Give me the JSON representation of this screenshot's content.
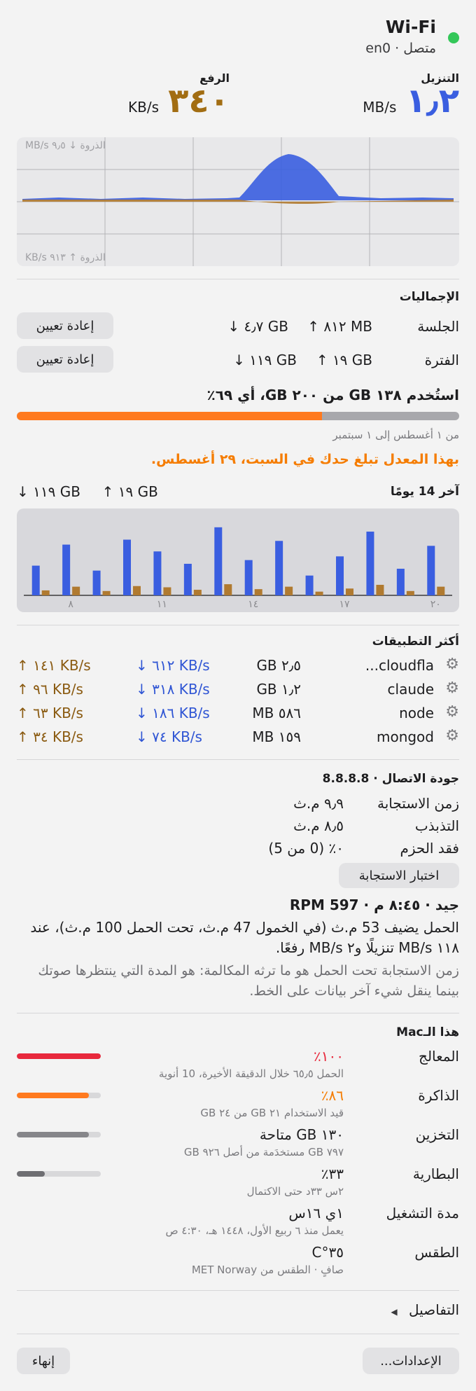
{
  "header": {
    "title": "Wi-Fi",
    "status": "متصل",
    "interface": "en0",
    "status_color": "#34c759",
    "download_label": "التنزيل",
    "download_value": "١٫٢",
    "download_unit": "MB/s",
    "upload_label": "الرفع",
    "upload_value": "٣٤٠",
    "upload_unit": "KB/s"
  },
  "graph": {
    "peak_down": "الذروة ↓ ٩٫٥ MB/s",
    "peak_up": "الذروة ↑ ٩١٣ KB/s",
    "download_color": "#3a5ee0",
    "upload_color": "#b07a30"
  },
  "totals": {
    "title": "الإجماليات",
    "session_label": "الجلسة",
    "session_up": "↑ ٨١٢ MB",
    "session_down": "↓ ٤٫٧ GB",
    "period_label": "الفترة",
    "period_up": "↑ ١٩ GB",
    "period_down": "↓ ١١٩ GB",
    "reset_label": "إعادة تعيين"
  },
  "usage": {
    "text": "استُخدم ١٣٨ GB من ٢٠٠ GB، أي ٦٩٪",
    "percent": 69,
    "bar_color": "#ff7a1f",
    "range": "من ١ أغسطس إلى ١ سبتمبر",
    "warning": "بهذا المعدل تبلغ حدك في السبت، ٢٩ أغسطس.",
    "warning_color": "#f57c00"
  },
  "history": {
    "title": "آخر 14 يومًا",
    "up": "↑ ١٩ GB",
    "down": "↓ ١١٩ GB"
  },
  "chart_data": {
    "type": "bar",
    "categories": [
      "",
      "٨",
      "",
      "",
      "١١",
      "",
      "",
      "١٤",
      "",
      "",
      "١٧",
      "",
      "",
      "٢٠"
    ],
    "series": [
      {
        "values": [
          4.8,
          8.2,
          4.0,
          9.0,
          7.1,
          5.1,
          11.0,
          5.7,
          8.8,
          3.2,
          6.3,
          10.3,
          4.3,
          8.0
        ]
      },
      {
        "values": [
          0.8,
          1.4,
          0.7,
          1.5,
          1.3,
          0.9,
          1.8,
          1.0,
          1.4,
          0.6,
          1.1,
          1.7,
          0.7,
          1.4
        ]
      }
    ]
  },
  "apps": {
    "title": "أكثر التطبيقات",
    "items": [
      {
        "name": "cloudfla...",
        "total": "٢٫٥ GB",
        "down": "↓ ٦١٢ KB/s",
        "up": "↑ ١٤١ KB/s"
      },
      {
        "name": "claude",
        "total": "١٫٢ GB",
        "down": "↓ ٣١٨ KB/s",
        "up": "↑ ٩٦ KB/s"
      },
      {
        "name": "node",
        "total": "٥٨٦ MB",
        "down": "↓ ١٨٦ KB/s",
        "up": "↑ ٦٣ KB/s"
      },
      {
        "name": "mongod",
        "total": "١٥٩ MB",
        "down": "↓ ٧٤ KB/s",
        "up": "↑ ٣٤ KB/s"
      }
    ]
  },
  "quality": {
    "title": "جودة الاتصال · 8.8.8.8",
    "latency_label": "زمن الاستجابة",
    "latency_value": "٩٫٩ م.ث",
    "jitter_label": "التذبذب",
    "jitter_value": "٨٫٥ م.ث",
    "loss_label": "فقد الحزم",
    "loss_value": "٠٪  (0 من 5)",
    "test_button": "اختبار الاستجابة",
    "summary": "جيد · ٨:٤٥ م · RPM 597",
    "load_text": "الحمل يضيف 53 م.ث (في الخمول 47 م.ث، تحت الحمل 100 م.ث)، عند ١١٨ MB/s تنزيلًا و٢ MB/s رفعًا.",
    "explain": "زمن الاستجابة تحت الحمل هو ما ترثه المكالمة: هو المدة التي ينتظرها صوتك بينما ينقل شيء آخر بيانات على الخط."
  },
  "mac": {
    "title": "هذا الـMac",
    "cpu_label": "المعالج",
    "cpu_value": "١٠٠٪",
    "cpu_sub": "الحمل ٦٥٫٥ خلال الدقيقة الأخيرة، 10 أنوية",
    "cpu_percent": 100,
    "cpu_color": "#e8283c",
    "mem_label": "الذاكرة",
    "mem_value": "٨٦٪",
    "mem_sub": "قيد الاستخدام ٢١ GB من ٢٤ GB",
    "mem_percent": 86,
    "mem_color": "#ff7a1f",
    "storage_label": "التخزين",
    "storage_value": "١٣٠ GB متاحة",
    "storage_sub": "٧٩٧ GB مستخدَمة من أصل ٩٢٦ GB",
    "storage_percent": 86,
    "storage_color": "#86868a",
    "battery_label": "البطارية",
    "battery_value": "٣٣٪",
    "battery_sub": "٢س ٣٣د حتى الاكتمال",
    "battery_percent": 33,
    "battery_color": "#6e6e72",
    "uptime_label": "مدة التشغيل",
    "uptime_value": "١ي ١٦س",
    "uptime_sub": "يعمل منذ ٦ ربيع الأول، ١٤٤٨ هـ، ٤:٣٠ ص",
    "weather_label": "الطقس",
    "weather_value": "٣٥°C",
    "weather_sub": "صافٍ · الطقس من MET Norway"
  },
  "details_label": "التفاصيل",
  "footer": {
    "settings": "الإعدادات...",
    "quit": "إنهاء"
  }
}
